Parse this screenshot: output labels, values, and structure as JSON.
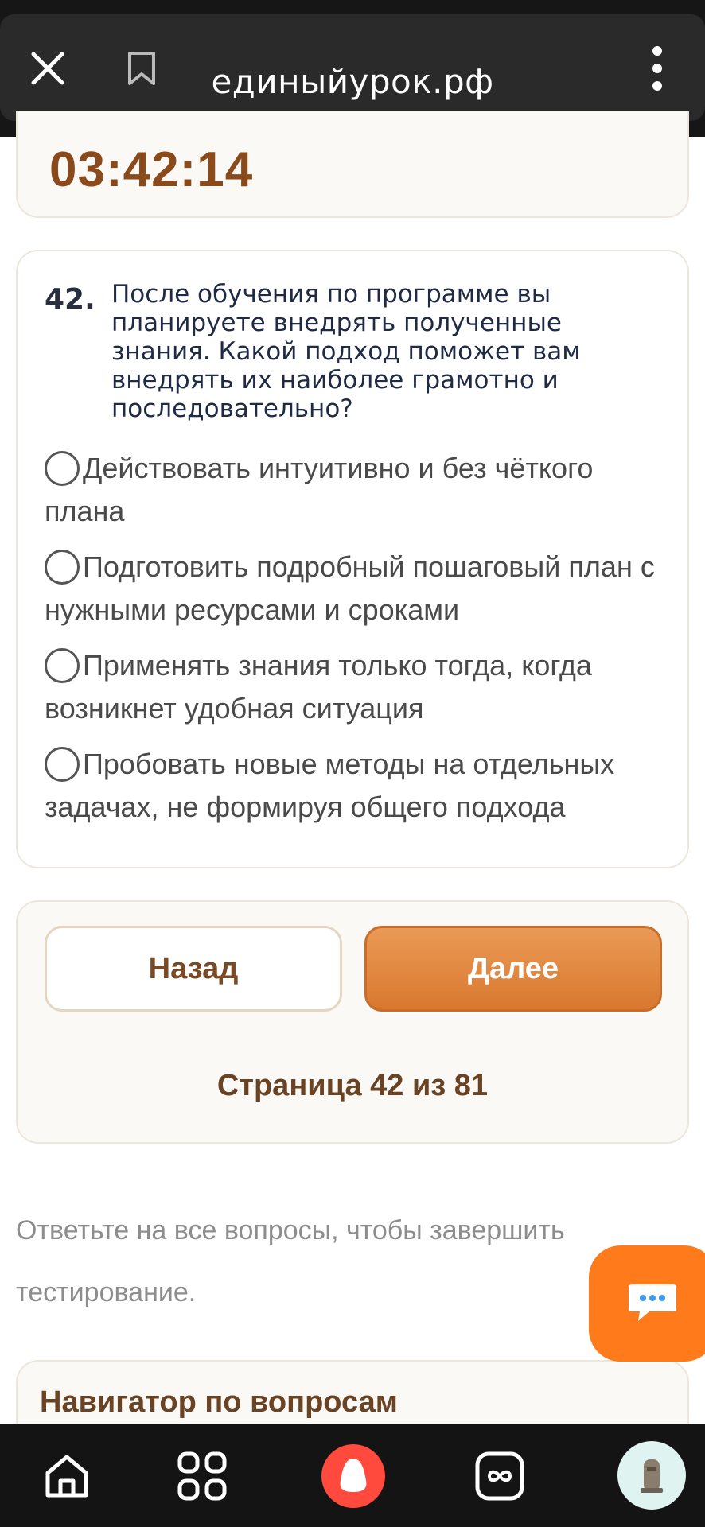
{
  "browser": {
    "url": "единыйурок.рф"
  },
  "timer": {
    "value": "03:42:14"
  },
  "question": {
    "number": "42.",
    "text": "После обучения по программе вы планируете внедрять полученные знания. Какой подход поможет вам внедрять их наиболее грамотно и последовательно?",
    "options": [
      "Действовать интуитивно и без чёткого плана",
      "Подготовить подробный пошаговый план с нужными ресурсами и сроками",
      "Применять знания только тогда, когда возникнет удобная ситуация",
      "Пробовать новые методы на отдельных задачах, не формируя общего подхода"
    ]
  },
  "navigation": {
    "back_label": "Назад",
    "next_label": "Далее",
    "page_label": "Страница 42 из 81"
  },
  "hint": "Ответьте на все вопросы, чтобы завершить тестирование.",
  "navigator": {
    "title": "Навигатор по вопросам"
  },
  "colors": {
    "accent": "#d9782e",
    "chat": "#ff7a1a",
    "brown": "#6a4324"
  }
}
